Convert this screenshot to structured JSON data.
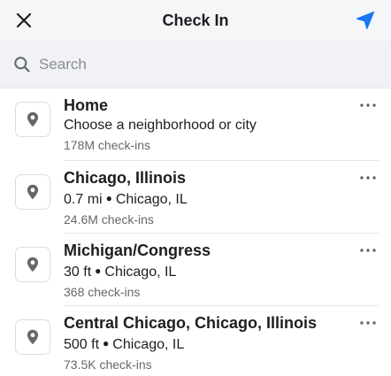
{
  "header": {
    "title": "Check In",
    "accent_color": "#1877f2"
  },
  "search": {
    "placeholder": "Search",
    "value": ""
  },
  "places": [
    {
      "name": "Home",
      "distance": "",
      "location": "Choose a neighborhood or city",
      "checkins": "178M check-ins"
    },
    {
      "name": "Chicago, Illinois",
      "distance": "0.7 mi",
      "location": "Chicago, IL",
      "checkins": "24.6M check-ins"
    },
    {
      "name": "Michigan/Congress",
      "distance": "30 ft",
      "location": "Chicago, IL",
      "checkins": "368 check-ins"
    },
    {
      "name": "Central Chicago, Chicago, Illinois",
      "distance": "500 ft",
      "location": "Chicago, IL",
      "checkins": "73.5K check-ins"
    }
  ],
  "icons": {
    "close": "close-icon",
    "location_arrow": "location-arrow-icon",
    "search": "search-icon",
    "pin": "map-pin-icon",
    "more": "more-icon"
  }
}
